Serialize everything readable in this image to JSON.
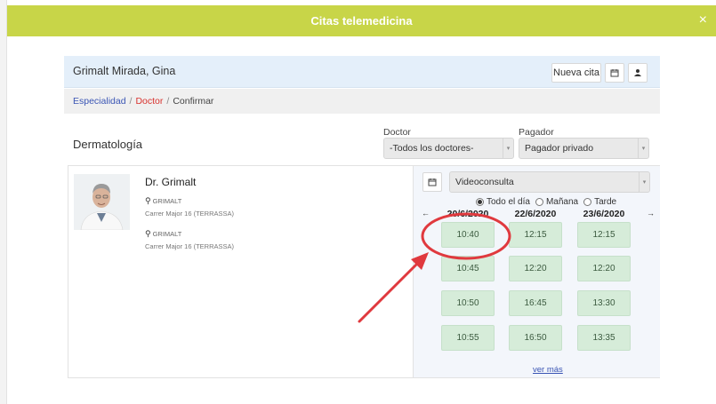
{
  "window": {
    "title": "Citas telemedicina",
    "close": "×"
  },
  "patient": {
    "name": "Grimalt Mirada, Gina",
    "new_button": "Nueva cita"
  },
  "breadcrumb": {
    "step1": "Especialidad",
    "sep": "/",
    "step2": "Doctor",
    "step3": "Confirmar"
  },
  "specialty": "Dermatología",
  "filters": {
    "doctor_label": "Doctor",
    "doctor_value": "-Todos los doctores-",
    "payer_label": "Pagador",
    "payer_value": "Pagador privado"
  },
  "doctor": {
    "name": "Dr. Grimalt",
    "locations": [
      {
        "name": "GRIMALT",
        "address": "Carrer Major 16 (TERRASSA)"
      },
      {
        "name": "GRIMALT",
        "address": "Carrer Major 16 (TERRASSA)"
      }
    ]
  },
  "schedule": {
    "mode": "Videoconsulta",
    "filters": [
      {
        "label": "Todo el día",
        "selected": true
      },
      {
        "label": "Mañana",
        "selected": false
      },
      {
        "label": "Tarde",
        "selected": false
      }
    ],
    "prev": "←",
    "next": "→",
    "days": [
      {
        "date": "20/6/2020",
        "slots": [
          "10:40",
          "10:45",
          "10:50",
          "10:55"
        ]
      },
      {
        "date": "22/6/2020",
        "slots": [
          "12:15",
          "12:20",
          "16:45",
          "16:50"
        ]
      },
      {
        "date": "23/6/2020",
        "slots": [
          "12:15",
          "12:20",
          "13:30",
          "13:35"
        ]
      }
    ],
    "more": "ver más"
  },
  "annotation": {
    "color": "#e0393e",
    "highlighted_slot": "10:40"
  },
  "colors": {
    "topbar": "#c8d548",
    "slot_bg": "#d6ecd9",
    "link": "#3a55b4",
    "crumb_active": "#d8322e"
  }
}
